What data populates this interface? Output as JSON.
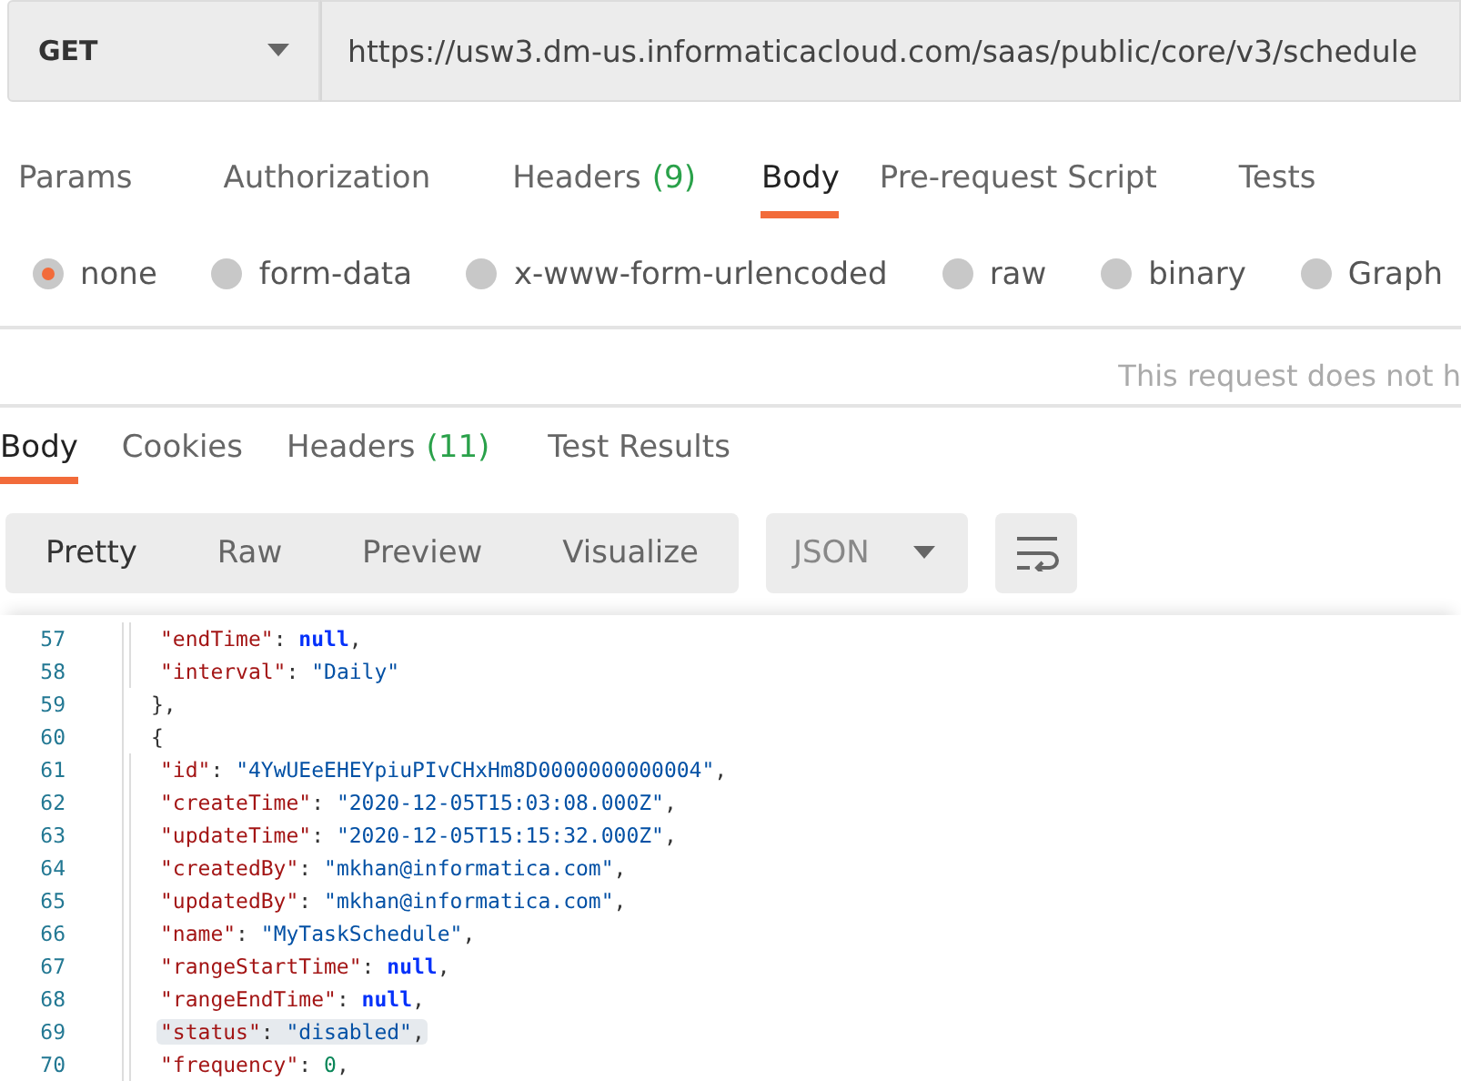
{
  "request": {
    "method": "GET",
    "url": "https://usw3.dm-us.informaticacloud.com/saas/public/core/v3/schedule"
  },
  "request_tabs": [
    {
      "label": "Params",
      "selected": false
    },
    {
      "label": "Authorization",
      "selected": false
    },
    {
      "label": "Headers",
      "count": "(9)",
      "selected": false
    },
    {
      "label": "Body",
      "selected": true
    },
    {
      "label": "Pre-request Script",
      "selected": false
    },
    {
      "label": "Tests",
      "selected": false
    }
  ],
  "body_types": [
    {
      "label": "none",
      "selected": true
    },
    {
      "label": "form-data",
      "selected": false
    },
    {
      "label": "x-www-form-urlencoded",
      "selected": false
    },
    {
      "label": "raw",
      "selected": false
    },
    {
      "label": "binary",
      "selected": false
    },
    {
      "label": "Graph",
      "selected": false
    }
  ],
  "body_message": "This request does not h",
  "response_tabs": [
    {
      "label": "Body",
      "selected": true
    },
    {
      "label": "Cookies",
      "selected": false
    },
    {
      "label": "Headers",
      "count": "(11)",
      "selected": false
    },
    {
      "label": "Test Results",
      "selected": false
    }
  ],
  "view_modes": [
    {
      "label": "Pretty",
      "selected": true
    },
    {
      "label": "Raw",
      "selected": false
    },
    {
      "label": "Preview",
      "selected": false
    },
    {
      "label": "Visualize",
      "selected": false
    }
  ],
  "format": "JSON",
  "code_lines": [
    {
      "number": "57",
      "kind": "member",
      "highlighted": false,
      "tokens": [
        {
          "kind": "key",
          "s": "\"endTime\""
        },
        {
          "kind": "punct",
          "s": ": "
        },
        {
          "kind": "null",
          "s": "null"
        },
        {
          "kind": "punct",
          "s": ","
        }
      ]
    },
    {
      "number": "58",
      "kind": "member",
      "highlighted": false,
      "tokens": [
        {
          "kind": "key",
          "s": "\"interval\""
        },
        {
          "kind": "punct",
          "s": ": "
        },
        {
          "kind": "string",
          "s": "\"Daily\""
        }
      ]
    },
    {
      "number": "59",
      "kind": "bracket",
      "highlighted": false,
      "tokens": [
        {
          "kind": "punct",
          "s": "},"
        }
      ]
    },
    {
      "number": "60",
      "kind": "bracket",
      "highlighted": false,
      "tokens": [
        {
          "kind": "punct",
          "s": "{"
        }
      ]
    },
    {
      "number": "61",
      "kind": "member",
      "highlighted": false,
      "tokens": [
        {
          "kind": "key",
          "s": "\"id\""
        },
        {
          "kind": "punct",
          "s": ": "
        },
        {
          "kind": "string",
          "s": "\"4YwUEeEHEYpiuPIvCHxHm8D0000000000004\""
        },
        {
          "kind": "punct",
          "s": ","
        }
      ]
    },
    {
      "number": "62",
      "kind": "member",
      "highlighted": false,
      "tokens": [
        {
          "kind": "key",
          "s": "\"createTime\""
        },
        {
          "kind": "punct",
          "s": ": "
        },
        {
          "kind": "string",
          "s": "\"2020-12-05T15:03:08.000Z\""
        },
        {
          "kind": "punct",
          "s": ","
        }
      ]
    },
    {
      "number": "63",
      "kind": "member",
      "highlighted": false,
      "tokens": [
        {
          "kind": "key",
          "s": "\"updateTime\""
        },
        {
          "kind": "punct",
          "s": ": "
        },
        {
          "kind": "string",
          "s": "\"2020-12-05T15:15:32.000Z\""
        },
        {
          "kind": "punct",
          "s": ","
        }
      ]
    },
    {
      "number": "64",
      "kind": "member",
      "highlighted": false,
      "tokens": [
        {
          "kind": "key",
          "s": "\"createdBy\""
        },
        {
          "kind": "punct",
          "s": ": "
        },
        {
          "kind": "string",
          "s": "\"mkhan@informatica.com\""
        },
        {
          "kind": "punct",
          "s": ","
        }
      ]
    },
    {
      "number": "65",
      "kind": "member",
      "highlighted": false,
      "tokens": [
        {
          "kind": "key",
          "s": "\"updatedBy\""
        },
        {
          "kind": "punct",
          "s": ": "
        },
        {
          "kind": "string",
          "s": "\"mkhan@informatica.com\""
        },
        {
          "kind": "punct",
          "s": ","
        }
      ]
    },
    {
      "number": "66",
      "kind": "member",
      "highlighted": false,
      "tokens": [
        {
          "kind": "key",
          "s": "\"name\""
        },
        {
          "kind": "punct",
          "s": ": "
        },
        {
          "kind": "string",
          "s": "\"MyTaskSchedule\""
        },
        {
          "kind": "punct",
          "s": ","
        }
      ]
    },
    {
      "number": "67",
      "kind": "member",
      "highlighted": false,
      "tokens": [
        {
          "kind": "key",
          "s": "\"rangeStartTime\""
        },
        {
          "kind": "punct",
          "s": ": "
        },
        {
          "kind": "null",
          "s": "null"
        },
        {
          "kind": "punct",
          "s": ","
        }
      ]
    },
    {
      "number": "68",
      "kind": "member",
      "highlighted": false,
      "tokens": [
        {
          "kind": "key",
          "s": "\"rangeEndTime\""
        },
        {
          "kind": "punct",
          "s": ": "
        },
        {
          "kind": "null",
          "s": "null"
        },
        {
          "kind": "punct",
          "s": ","
        }
      ]
    },
    {
      "number": "69",
      "kind": "member",
      "highlighted": true,
      "tokens": [
        {
          "kind": "key",
          "s": "\"status\""
        },
        {
          "kind": "punct",
          "s": ": "
        },
        {
          "kind": "string",
          "s": "\"disabled\""
        },
        {
          "kind": "punct",
          "s": ","
        }
      ]
    },
    {
      "number": "70",
      "kind": "member",
      "highlighted": false,
      "tokens": [
        {
          "kind": "key",
          "s": "\"frequency\""
        },
        {
          "kind": "punct",
          "s": ": "
        },
        {
          "kind": "number",
          "s": "0"
        },
        {
          "kind": "punct",
          "s": ","
        }
      ]
    }
  ]
}
